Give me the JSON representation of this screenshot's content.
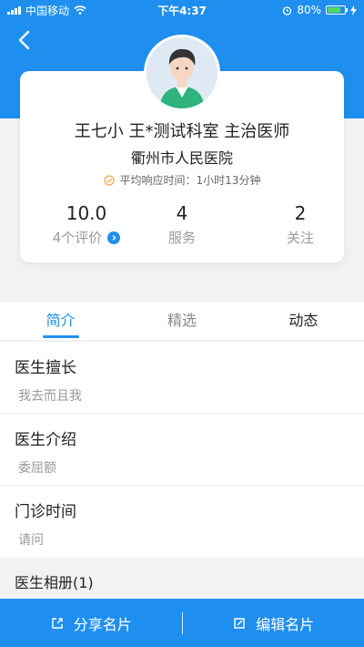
{
  "status_bar": {
    "carrier": "中国移动",
    "time": "下午4:37",
    "battery": "80%",
    "battery_level": 0.8
  },
  "doctor": {
    "name_line": "王七小  王*测试科室  主治医师",
    "hospital": "衢州市人民医院",
    "response_time": "平均响应时间：1小时13分钟"
  },
  "stats": {
    "rating_value": "10.0",
    "rating_label": "4个评价",
    "service_value": "4",
    "service_label": "服务",
    "follow_value": "2",
    "follow_label": "关注"
  },
  "tabs": [
    {
      "label": "简介"
    },
    {
      "label": "精选"
    },
    {
      "label": "动态"
    }
  ],
  "sections": [
    {
      "title": "医生擅长",
      "value": "我去而且我"
    },
    {
      "title": "医生介绍",
      "value": "委屈额"
    },
    {
      "title": "门诊时间",
      "value": "请问"
    }
  ],
  "album": {
    "label": "医生相册(1)"
  },
  "bottom_bar": {
    "share_label": "分享名片",
    "edit_label": "编辑名片"
  },
  "colors": {
    "accent": "#1f8fef",
    "background": "#f2f2f4"
  }
}
